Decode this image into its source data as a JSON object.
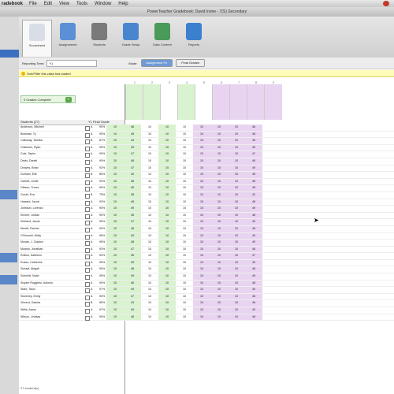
{
  "menubar": {
    "app": "radebook",
    "items": [
      "File",
      "Edit",
      "View",
      "Tools",
      "Window",
      "Help"
    ]
  },
  "window": {
    "title": "PowerTeacher Gradebook: David Irvine - 7(S) Secondary"
  },
  "toolbar": {
    "items": [
      {
        "label": "Scoresheet",
        "color": "#d8dde6"
      },
      {
        "label": "Assignments",
        "color": "#5b8fd6"
      },
      {
        "label": "Students",
        "color": "#7a7a7a"
      },
      {
        "label": "Grade Setup",
        "color": "#4a86d0"
      },
      {
        "label": "Data Content",
        "color": "#4a9a5a"
      },
      {
        "label": "Reports",
        "color": "#3b7fcf"
      }
    ]
  },
  "filter": {
    "term_label": "Reporting Term:",
    "term_value": "Y1",
    "mode_label": "Mode:",
    "mode_on": "Assignment Fn",
    "mode_off": "Final Grades"
  },
  "notice": "Sort/Filter this class has loaded",
  "status_complete": "0 Grades Complete",
  "columns": {
    "student": "Students (27)",
    "final": "Y1 Final Grade"
  },
  "assignments": [
    {
      "num": "1",
      "color": "#d9f2cf"
    },
    {
      "num": "2",
      "color": "#d9f2cf"
    },
    {
      "num": "3",
      "color": "#ffffff"
    },
    {
      "num": "4",
      "color": "#d9f2cf"
    },
    {
      "num": "5",
      "color": "#ffffff"
    },
    {
      "num": "6",
      "color": "#e8d4f0"
    },
    {
      "num": "7",
      "color": "#e8d4f0"
    },
    {
      "num": "8",
      "color": "#e8d4f0"
    },
    {
      "num": "9",
      "color": "#e8d4f0"
    }
  ],
  "students": [
    {
      "name": "Anderson, Mitchell",
      "per": "A",
      "pct": "90%",
      "ltr": "A-A",
      "scores": [
        "10",
        "48",
        "10",
        "10",
        "10",
        "10",
        "10",
        "10",
        "46"
      ]
    },
    {
      "name": "Bowman, Ty",
      "per": "A",
      "pct": "90%",
      "ltr": "A-A",
      "scores": [
        "10",
        "45",
        "10",
        "10",
        "10",
        "10",
        "10",
        "10",
        "48"
      ]
    },
    {
      "name": "Calloway, Tamika",
      "per": "B",
      "pct": "87%",
      "ltr": "A-A",
      "scores": [
        "10",
        "44",
        "10",
        "10",
        "10",
        "10",
        "10",
        "10",
        "46"
      ]
    },
    {
      "name": "Chisholm, Ryan",
      "per": "A",
      "pct": "95%",
      "ltr": "A-A",
      "scores": [
        "10",
        "49",
        "10",
        "10",
        "10",
        "10",
        "10",
        "10",
        "49"
      ]
    },
    {
      "name": "Cole, Taylor",
      "per": "A",
      "pct": "90%",
      "ltr": "A-A",
      "scores": [
        "10",
        "47",
        "10",
        "10",
        "10",
        "10",
        "10",
        "10",
        "47"
      ]
    },
    {
      "name": "Davis, Daniel",
      "per": "A",
      "pct": "90%",
      "ltr": "A-A",
      "scores": [
        "10",
        "48",
        "10",
        "10",
        "10",
        "10",
        "10",
        "10",
        "48"
      ]
    },
    {
      "name": "Drowns, Brian",
      "per": "A",
      "pct": "92%",
      "ltr": "A-A",
      "scores": [
        "10",
        "47",
        "10",
        "10",
        "10",
        "10",
        "10",
        "10",
        "49"
      ]
    },
    {
      "name": "Durham, Elle",
      "per": "B",
      "pct": "80%",
      "ltr": "A-A",
      "scores": [
        "10",
        "40",
        "10",
        "10",
        "10",
        "10",
        "10",
        "10",
        "45"
      ]
    },
    {
      "name": "Garrett, Leslie",
      "per": "A",
      "pct": "93%",
      "ltr": "A-A",
      "scores": [
        "10",
        "48",
        "10",
        "10",
        "10",
        "10",
        "10",
        "10",
        "48"
      ]
    },
    {
      "name": "Gibson, Trevor",
      "per": "A",
      "pct": "90%",
      "ltr": "A-A",
      "scores": [
        "10",
        "46",
        "10",
        "10",
        "10",
        "10",
        "10",
        "10",
        "48"
      ]
    },
    {
      "name": "Gould, Eva",
      "per": "B",
      "pct": "75%",
      "ltr": "A-A",
      "scores": [
        "10",
        "38",
        "10",
        "10",
        "10",
        "10",
        "10",
        "10",
        "42"
      ]
    },
    {
      "name": "Howard, Jacob",
      "per": "A",
      "pct": "93%",
      "ltr": "A-A",
      "scores": [
        "10",
        "48",
        "10",
        "10",
        "10",
        "10",
        "10",
        "10",
        "48"
      ]
    },
    {
      "name": "Johnson, Lorenzo",
      "per": "A",
      "pct": "95%",
      "ltr": "A-A",
      "scores": [
        "10",
        "49",
        "10",
        "10",
        "10",
        "10",
        "10",
        "10",
        "49"
      ]
    },
    {
      "name": "Kircher, Jordan",
      "per": "A",
      "pct": "90%",
      "ltr": "A-A",
      "scores": [
        "10",
        "45",
        "10",
        "10",
        "10",
        "10",
        "10",
        "10",
        "48"
      ]
    },
    {
      "name": "Kirkland, Jacob",
      "per": "A",
      "pct": "95%",
      "ltr": "A-A",
      "scores": [
        "10",
        "47",
        "10",
        "10",
        "10",
        "10",
        "10",
        "10",
        "49"
      ]
    },
    {
      "name": "Merritt, Rachel",
      "per": "A",
      "pct": "90%",
      "ltr": "A-A",
      "scores": [
        "10",
        "48",
        "10",
        "10",
        "10",
        "10",
        "10",
        "10",
        "48"
      ]
    },
    {
      "name": "O'Donnell, Molly",
      "per": "A",
      "pct": "95%",
      "ltr": "A-A",
      "scores": [
        "10",
        "49",
        "10",
        "10",
        "10",
        "10",
        "10",
        "10",
        "49"
      ]
    },
    {
      "name": "Mcnab, J. Clayton",
      "per": "A",
      "pct": "95%",
      "ltr": "A-A",
      "scores": [
        "10",
        "48",
        "10",
        "10",
        "10",
        "10",
        "10",
        "10",
        "49"
      ]
    },
    {
      "name": "Murphy, Jonathan",
      "per": "A",
      "pct": "93%",
      "ltr": "A-A",
      "scores": [
        "10",
        "47",
        "10",
        "10",
        "10",
        "10",
        "10",
        "10",
        "48"
      ]
    },
    {
      "name": "Rollins, Kathleen",
      "per": "A",
      "pct": "90%",
      "ltr": "A-A",
      "scores": [
        "10",
        "46",
        "10",
        "10",
        "10",
        "10",
        "10",
        "10",
        "47"
      ]
    },
    {
      "name": "Russo, Catherine",
      "per": "A",
      "pct": "95%",
      "ltr": "A-A",
      "scores": [
        "10",
        "49",
        "10",
        "10",
        "10",
        "10",
        "10",
        "10",
        "49"
      ]
    },
    {
      "name": "Schaaf, Abigail",
      "per": "A",
      "pct": "90%",
      "ltr": "A-A",
      "scores": [
        "10",
        "48",
        "10",
        "10",
        "10",
        "10",
        "10",
        "10",
        "48"
      ]
    },
    {
      "name": "Schmidt, Noah",
      "per": "A",
      "pct": "95%",
      "ltr": "A-A",
      "scores": [
        "10",
        "49",
        "10",
        "10",
        "10",
        "10",
        "10",
        "10",
        "49"
      ]
    },
    {
      "name": "Snyder Ruggiero, Antonio",
      "per": "A",
      "pct": "90%",
      "ltr": "A-A",
      "scores": [
        "10",
        "46",
        "10",
        "10",
        "10",
        "10",
        "10",
        "10",
        "48"
      ]
    },
    {
      "name": "Stahl, Tarun",
      "per": "A",
      "pct": "97%",
      "ltr": "A-A",
      "scores": [
        "10",
        "49",
        "10",
        "10",
        "10",
        "10",
        "10",
        "10",
        "49"
      ]
    },
    {
      "name": "Sweeney, Emily",
      "per": "A",
      "pct": "90%",
      "ltr": "A-A",
      "scores": [
        "10",
        "47",
        "10",
        "10",
        "10",
        "10",
        "10",
        "10",
        "48"
      ]
    },
    {
      "name": "Vincent, Dakota",
      "per": "B",
      "pct": "85%",
      "ltr": "A-A",
      "scores": [
        "10",
        "43",
        "10",
        "10",
        "10",
        "10",
        "10",
        "10",
        "46"
      ]
    },
    {
      "name": "Wells, Aaron",
      "per": "A",
      "pct": "97%",
      "ltr": "A-A",
      "scores": [
        "10",
        "49",
        "10",
        "10",
        "10",
        "10",
        "10",
        "10",
        "49"
      ]
    },
    {
      "name": "Wilson, Lindsay",
      "per": "A",
      "pct": "90%",
      "ltr": "A-A",
      "scores": [
        "10",
        "46",
        "10",
        "10",
        "10",
        "10",
        "10",
        "10",
        "48"
      ]
    }
  ],
  "footer": "27 student(s)"
}
